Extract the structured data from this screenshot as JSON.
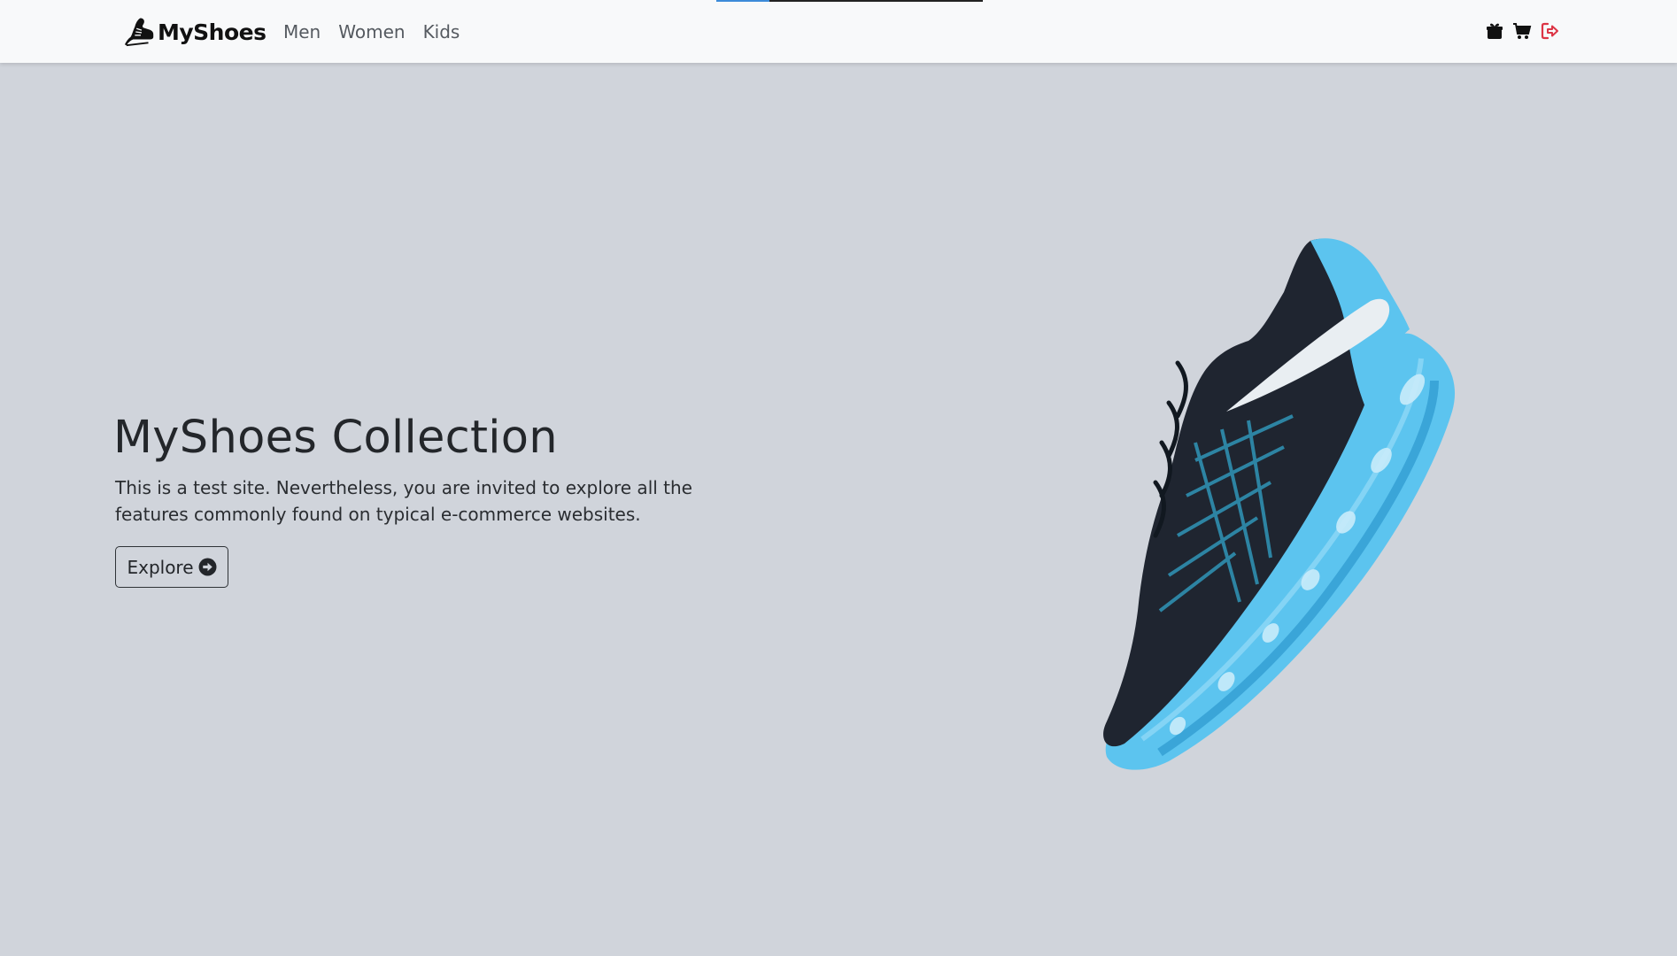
{
  "brand": {
    "name": "MyShoes",
    "icon": "running-shoe-icon"
  },
  "nav": {
    "links": [
      {
        "label": "Men"
      },
      {
        "label": "Women"
      },
      {
        "label": "Kids"
      }
    ],
    "icons": [
      "gift-icon",
      "cart-icon",
      "sign-out-icon"
    ]
  },
  "loading_bar": {
    "progress": 0.2
  },
  "hero": {
    "title": "MyShoes Collection",
    "description": "This is a test site. Nevertheless, you are invited to explore all the features commonly found on typical e-commerce websites.",
    "button_label": "Explore",
    "button_icon": "arrow-circle-right-icon",
    "image": "sneaker-image"
  },
  "colors": {
    "page_background": "#d0d4db",
    "navbar_background": "#f8f9fa",
    "sign_out_red": "#dc3545",
    "shoe_blue": "#5cc4ef",
    "shoe_dark": "#1f2530"
  }
}
